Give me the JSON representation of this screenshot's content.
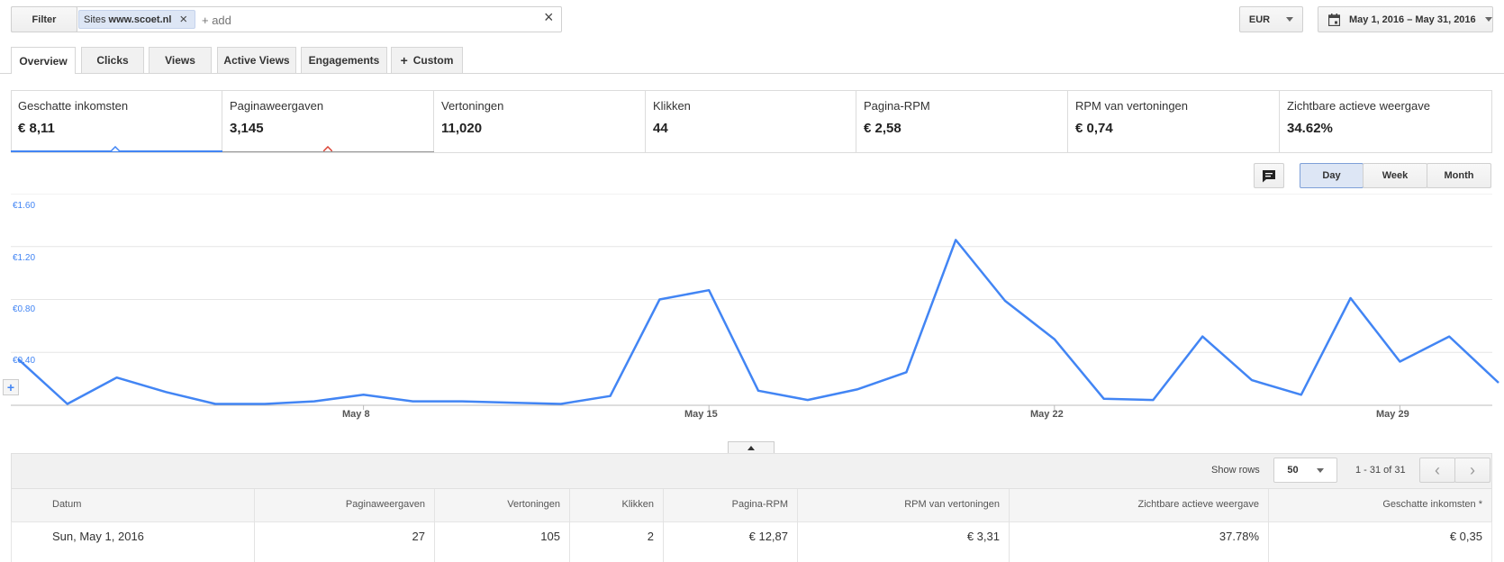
{
  "filter": {
    "button_label": "Filter",
    "chip_prefix": "Sites",
    "chip_value": "www.scoet.nl",
    "add_placeholder": "+ add"
  },
  "currency": {
    "value": "EUR"
  },
  "date_range": {
    "value": "May 1, 2016 – May 31, 2016"
  },
  "tabs": [
    {
      "label": "Overview",
      "active": true
    },
    {
      "label": "Clicks"
    },
    {
      "label": "Views"
    },
    {
      "label": "Active Views"
    },
    {
      "label": "Engagements"
    },
    {
      "label": "Custom"
    }
  ],
  "metrics": [
    {
      "label": "Geschatte inkomsten",
      "value": "€ 8,11",
      "selected": true,
      "accent": "#4285f4"
    },
    {
      "label": "Paginaweergaven",
      "value": "3,145",
      "selected": true,
      "accent": "#db4437"
    },
    {
      "label": "Vertoningen",
      "value": "11,020"
    },
    {
      "label": "Klikken",
      "value": "44"
    },
    {
      "label": "Pagina-RPM",
      "value": "€ 2,58"
    },
    {
      "label": "RPM van vertoningen",
      "value": "€ 0,74"
    },
    {
      "label": "Zichtbare actieve weergave",
      "value": "34.62%"
    }
  ],
  "granularity": {
    "day": "Day",
    "week": "Week",
    "month": "Month",
    "selected": "Day"
  },
  "chart_data": {
    "type": "line",
    "y_ticks": [
      "€1.60",
      "€1.20",
      "€0.80",
      "€0.40"
    ],
    "ylim": [
      0,
      1.6
    ],
    "x_ticks": [
      {
        "label": "May 8",
        "day": 8
      },
      {
        "label": "May 15",
        "day": 15
      },
      {
        "label": "May 22",
        "day": 22
      },
      {
        "label": "May 29",
        "day": 29
      }
    ],
    "color": "#4285f4",
    "x": [
      1,
      2,
      3,
      4,
      5,
      6,
      7,
      8,
      9,
      10,
      11,
      12,
      13,
      14,
      15,
      16,
      17,
      18,
      19,
      20,
      21,
      22,
      23,
      24,
      25,
      26,
      27,
      28,
      29,
      30,
      31
    ],
    "values": [
      0.35,
      0.01,
      0.21,
      0.1,
      0.01,
      0.01,
      0.03,
      0.08,
      0.03,
      0.03,
      0.02,
      0.01,
      0.07,
      0.8,
      0.87,
      0.11,
      0.04,
      0.12,
      0.25,
      1.25,
      0.79,
      0.5,
      0.05,
      0.04,
      0.52,
      0.19,
      0.08,
      0.81,
      0.33,
      0.52,
      0.17
    ]
  },
  "table": {
    "show_rows_label": "Show rows",
    "rows_per_page": "50",
    "pagination": "1 - 31 of 31",
    "columns": [
      "Datum",
      "Paginaweergaven",
      "Vertoningen",
      "Klikken",
      "Pagina-RPM",
      "RPM van vertoningen",
      "Zichtbare actieve weergave",
      "Geschatte inkomsten *"
    ],
    "rows": [
      [
        "Sun, May 1, 2016",
        "27",
        "105",
        "2",
        "€ 12,87",
        "€ 3,31",
        "37.78%",
        "€ 0,35"
      ]
    ]
  }
}
